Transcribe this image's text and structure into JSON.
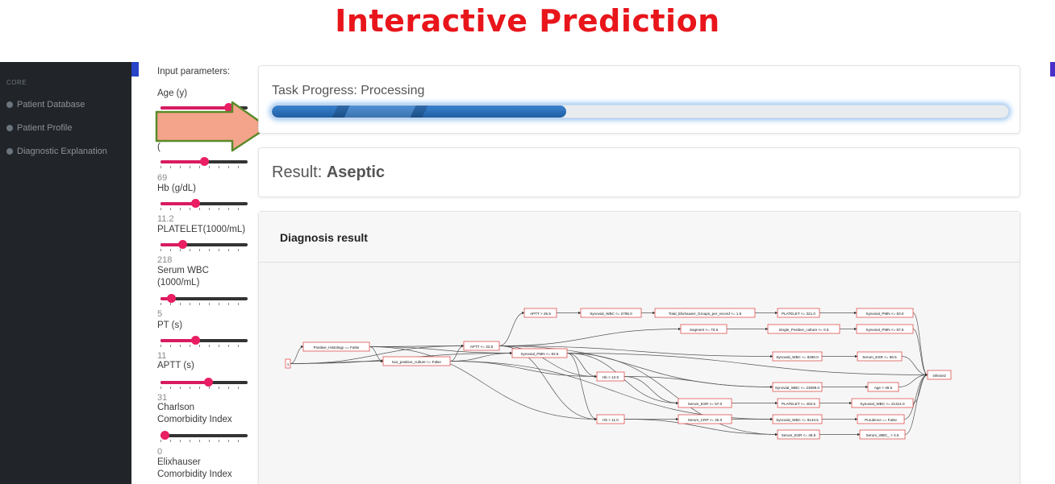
{
  "page_title": "Interactive Prediction",
  "sidebar": {
    "heading": "CORE",
    "items": [
      {
        "label": "Patient Database"
      },
      {
        "label": "Patient Profile"
      },
      {
        "label": "Diagnostic Explanation"
      }
    ]
  },
  "params": {
    "heading": "Input parameters:",
    "fields": [
      {
        "label": "Age (y)",
        "value": "",
        "fraction": 0.78
      },
      {
        "label": "(",
        "value": "69",
        "fraction": 0.5
      },
      {
        "label": "Hb (g/dL)",
        "value": "11.2",
        "fraction": 0.4
      },
      {
        "label": "PLATELET(1000/mL)",
        "value": "218",
        "fraction": 0.25
      },
      {
        "label": "Serum WBC (1000/mL)",
        "value": "5",
        "fraction": 0.12
      },
      {
        "label": "PT (s)",
        "value": "11",
        "fraction": 0.4
      },
      {
        "label": "APTT (s)",
        "value": "31",
        "fraction": 0.55
      },
      {
        "label": "Charlson Comorbidity Index",
        "value": "0",
        "fraction": 0.02
      },
      {
        "label": "Elixhauser Comorbidity Index",
        "value": "",
        "fraction": 0
      }
    ]
  },
  "progress": {
    "title": "Task Progress: Processing",
    "fraction": 0.4,
    "color": "#2a6fbf"
  },
  "result": {
    "prefix": "Result: ",
    "value": "Aseptic"
  },
  "diagnosis": {
    "title": "Diagnosis result",
    "nodes": {
      "root": "1",
      "n1": "Positive_Histology == False",
      "n2": "two_positive_culture <= False",
      "n3": "APTT <= 32.5",
      "n4": "Synovial_PMN <= 82.5",
      "n5": "APTT > 26.5",
      "n6": "Synovial_WBC <= 2795.0",
      "n7": "Total_Elixhauser_Groups_per_record <= 1.5",
      "n8": "PLATELET <= 321.0",
      "n9": "Synovial_PMN <= 83.0",
      "n10": "Segment <= 70.5",
      "n11": "Single_Positive_culture <= 0.5",
      "n12": "Synovial_PMN <= 87.5",
      "n13": "Synovial_WBC <= 8280.0",
      "n14": "Serum_ESR <= 56.5",
      "n15": "Hb > 12.5",
      "n16": "Synovial_WBC <= 23099.0",
      "n17": "Age > 48.5",
      "n18": "infected",
      "n19": "Serum_ESR <= 57.0",
      "n20": "PLATELET <= 402.5",
      "n21": "Synovial_WBC <= 21314.0",
      "n22": "Hb > 11.0",
      "n23": "Serum_CRP <= 25.0",
      "n24": "Synovial_WBC <= 8143.5",
      "n25": "Purulence == False",
      "n26": "Serum_ESR <= 46.5",
      "n27": "Serum_WBC_ > 4.5"
    }
  },
  "colors": {
    "title": "#e8151b",
    "slider": "#e91e63",
    "arrow_fill": "#f4a48a",
    "arrow_stroke": "#5a8a2a",
    "node_border": "#e05050"
  },
  "icons": {
    "nav": "circle-icon",
    "pointer": "arrow-right-icon"
  }
}
